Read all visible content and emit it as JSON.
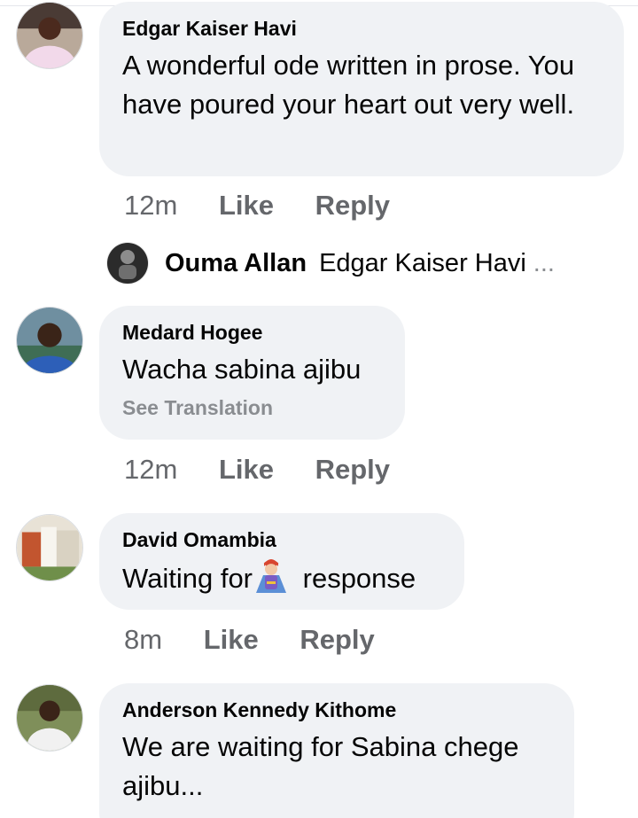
{
  "comments": [
    {
      "author": "Edgar Kaiser Havi",
      "text": "A wonderful ode written in prose. You have poured your heart out very well.",
      "time": "12m",
      "like_label": "Like",
      "reply_label": "Reply"
    },
    {
      "author": "Medard Hogee",
      "text": "Wacha sabina ajibu",
      "see_translation": "See Translation",
      "time": "12m",
      "like_label": "Like",
      "reply_label": "Reply"
    },
    {
      "author": "David Omambia",
      "text_before": "Waiting for",
      "sticker": "superhero-woman-sticker",
      "text_after": " response",
      "time": "8m",
      "like_label": "Like",
      "reply_label": "Reply"
    },
    {
      "author": "Anderson Kennedy Kithome",
      "text": "We are waiting for Sabina chege ajibu..."
    }
  ],
  "reply_preview": {
    "author": "Ouma Allan",
    "text": "Edgar Kaiser Havi",
    "ellipsis": "..."
  },
  "colors": {
    "bubble_bg": "#f0f2f5",
    "meta_text": "#65676b",
    "translate_text": "#8a8d91",
    "primary_text": "#050505"
  }
}
